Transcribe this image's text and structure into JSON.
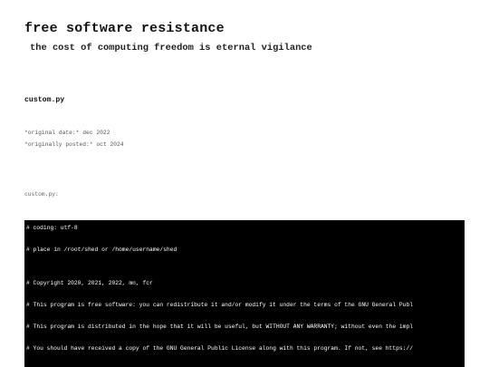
{
  "header": {
    "site_title": "free software resistance",
    "site_subtitle": "the cost of computing freedom is eternal vigilance"
  },
  "post": {
    "title": "custom.py",
    "meta": {
      "original_date_label": "*original date:*",
      "original_date_value": "dec 2022",
      "posted_label": "*originally posted:*",
      "posted_value": "oct 2024"
    },
    "file_label": "custom.py:"
  },
  "code": {
    "lines": [
      "# coding: utf-8",
      "# place in /root/shed or /home/username/shed",
      "# Copyright 2020, 2021, 2022, mn, fcr",
      "# This program is free software: you can redistribute it and/or modify it under the terms of the GNU General Publ",
      "# This program is distributed in the hope that it will be useful, but WITHOUT ANY WARRANTY; without even the impl",
      "# You should have received a copy of the GNU General Public License along with this program. If not, see https://"
    ]
  }
}
